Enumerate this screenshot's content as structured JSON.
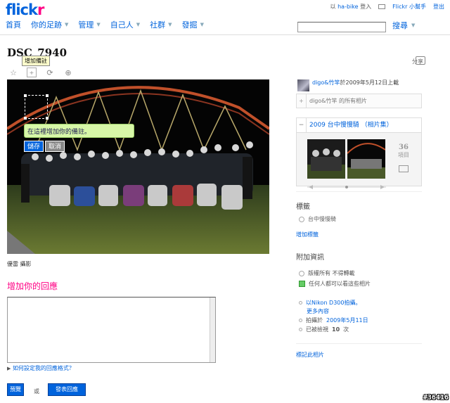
{
  "header": {
    "logo_left": "flick",
    "logo_right": "r",
    "signed_in_prefix": "以",
    "username": "ha-bike",
    "signed_in_suffix": "登入",
    "helper": "Flickr 小幫手",
    "logout": "登出"
  },
  "nav": {
    "items": [
      "首頁",
      "你的足跡",
      "管理",
      "自己人",
      "社群",
      "發掘"
    ],
    "search_label": "搜尋",
    "search_placeholder": ""
  },
  "photo": {
    "title": "DSC_7940",
    "share": "分享",
    "tooltip": "增加備註",
    "note_text": "在這裡增加你的備註。",
    "note_save": "儲存",
    "note_cancel": "取消",
    "caption": "優雷 攝影"
  },
  "comments": {
    "heading": "增加你的回應",
    "textarea_value": "",
    "howto": "如何設定我的回應格式？",
    "preview": "預覽",
    "or": "或",
    "post": "發表回應"
  },
  "sidebar": {
    "uploader_name": "digo&竹竿",
    "uploaded_text": "於2009年5月12日上載",
    "all_photos": "digo&竹竿 的所有相片",
    "set_title": "2009 台中慢慢騎 （相片集）",
    "set_count_number": "36",
    "set_count_unit": "項目",
    "tags_heading": "標籤",
    "tag": "台中慢慢騎",
    "add_tag": "增加標籤",
    "additional_heading": "附加資訊",
    "license": "版權所有 不得轉載",
    "permission": "任何人都可以看這些相片",
    "camera": "以Nikon D300拍攝。",
    "more_properties": "更多內容",
    "taken_on_label": "拍攝於",
    "taken_on": "2009年5月11日",
    "views_prefix": "已被檢視",
    "views": "10",
    "views_suffix": "次",
    "flag": "標記此相片"
  },
  "watermark": "#36416",
  "colors": {
    "flickr_blue": "#0063dc",
    "flickr_pink": "#ff0084",
    "note_green": "#d7f7a8"
  },
  "icons": [
    "star-icon",
    "note-icon",
    "rotate-icon",
    "zoom-icon",
    "share-icon",
    "mail-icon",
    "slideshow-icon",
    "cc-icon",
    "camera-dot-icon"
  ]
}
